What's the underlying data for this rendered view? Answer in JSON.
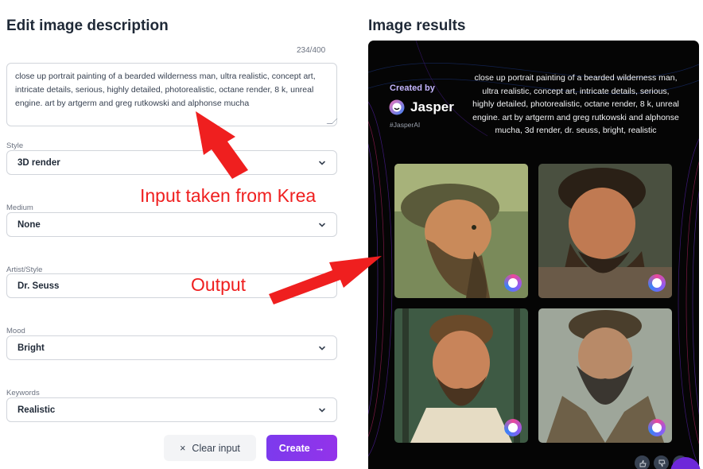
{
  "left_panel": {
    "title": "Edit image description",
    "char_counter": "234/400",
    "description": "close up portrait painting of a bearded wilderness man, ultra realistic, concept art, intricate details, serious, highly detailed, photorealistic, octane render, 8 k, unreal engine. art by artgerm and greg rutkowski and alphonse mucha",
    "fields": {
      "style": {
        "label": "Style",
        "value": "3D render"
      },
      "medium": {
        "label": "Medium",
        "value": "None"
      },
      "artist": {
        "label": "Artist/Style",
        "value": "Dr. Seuss"
      },
      "mood": {
        "label": "Mood",
        "value": "Bright"
      },
      "keywords": {
        "label": "Keywords",
        "value": "Realistic"
      }
    },
    "clear_button": {
      "icon": "×",
      "label": "Clear input"
    },
    "create_button": {
      "label": "Create",
      "icon": "→"
    }
  },
  "annotations": {
    "input_note": "Input taken from Krea",
    "output_note": "Output",
    "arrow_color": "#ef1f1f"
  },
  "right_panel": {
    "title": "Image results",
    "created_by": "Created by",
    "brand": "Jasper",
    "hashtag": "#JasperAI",
    "prompt": "close up portrait painting of a bearded wilderness man, ultra realistic, concept art, intricate details, serious, highly detailed, photorealistic, octane render, 8 k, unreal engine. art by artgerm and greg rutkowski and alphonse mucha, 3d render, dr. seuss, bright, realistic",
    "accent": "#7c3aed"
  }
}
